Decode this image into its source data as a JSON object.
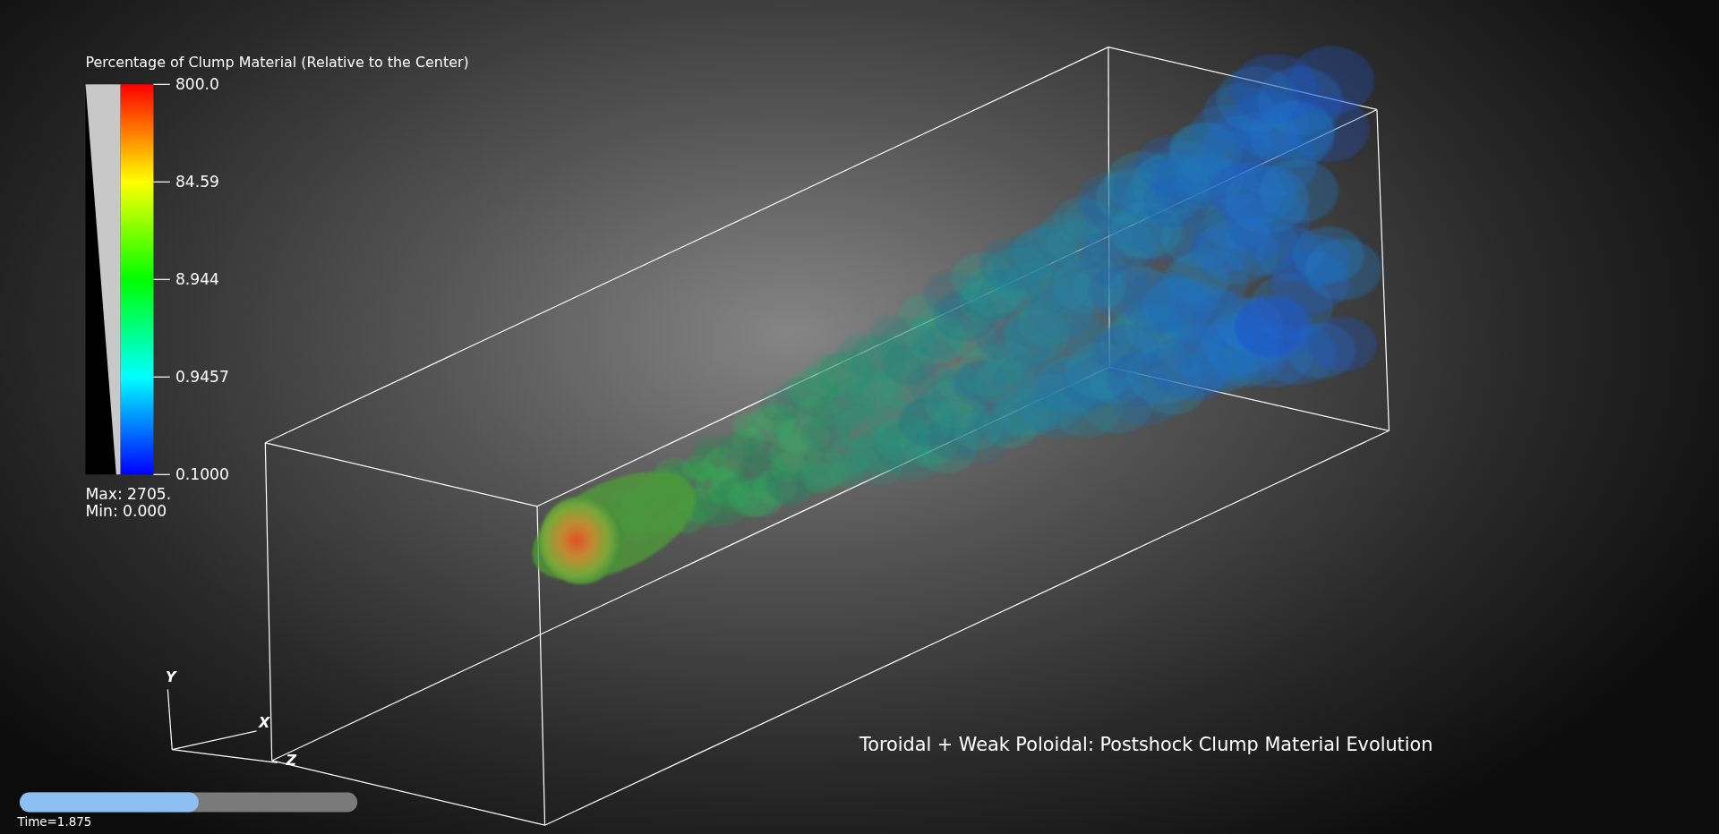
{
  "legend": {
    "title": "Percentage of Clump Material (Relative to the Center)",
    "ticks": [
      "800.0",
      "84.59",
      "8.944",
      "0.9457",
      "0.1000"
    ],
    "max_label": "Max:  2705.",
    "min_label": "Min:  0.000"
  },
  "axes": {
    "y_label": "Y",
    "x_label": "X",
    "z_label": "Z"
  },
  "plot_title": "Toroidal + Weak Poloidal: Postshock Clump Material Evolution",
  "time_slider": {
    "level": 0.53,
    "label": "Time=1.875"
  }
}
